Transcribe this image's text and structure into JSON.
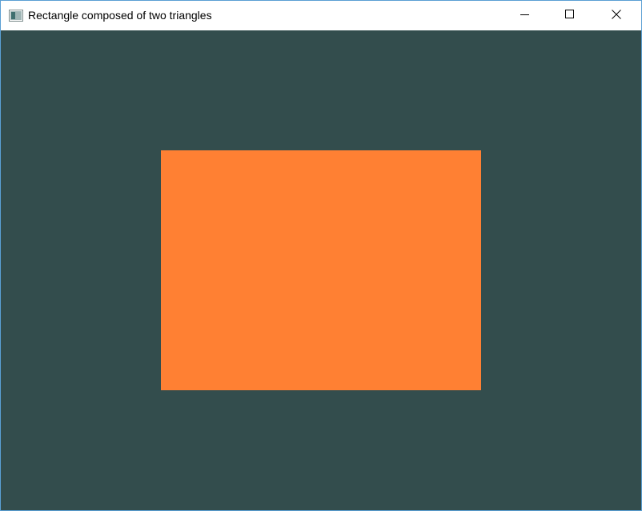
{
  "window": {
    "title": "Rectangle composed of two triangles"
  },
  "title_bar": {
    "icon": "app-window-icon",
    "minimize_icon": "minimize-icon",
    "maximize_icon": "maximize-icon",
    "close_icon": "close-icon"
  },
  "colors": {
    "clear_color": "#334d4d",
    "rectangle_fill": "#ff8033",
    "title_bar_bg": "#ffffff",
    "window_border": "#5a9fd4"
  }
}
